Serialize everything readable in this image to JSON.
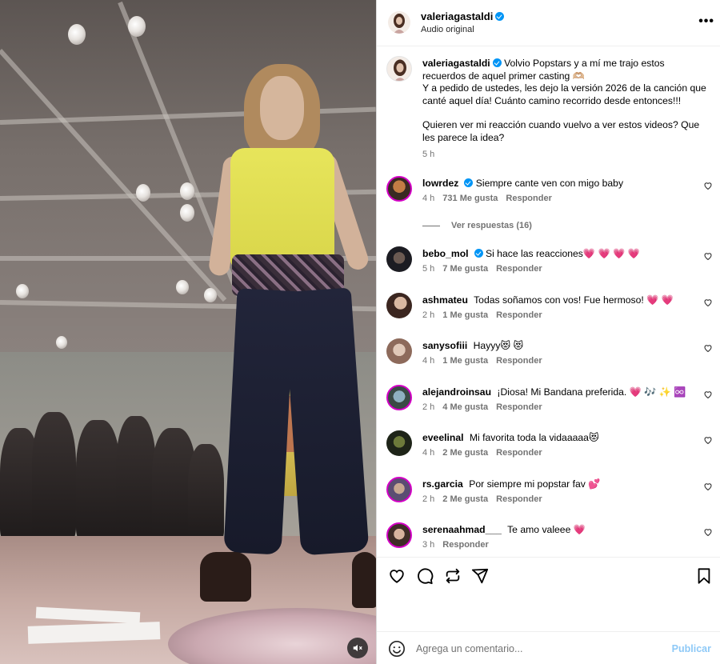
{
  "header": {
    "username": "valeriagastaldi",
    "audio": "Audio original",
    "more": "•••"
  },
  "caption": {
    "username": "valeriagastaldi",
    "line1": "Volvio Popstars y a mí me trajo estos recuerdos de aquel primer casting 🫶🏼",
    "line2": "Y a pedido de ustedes, les dejo la versión 2026 de la canción que canté aquel día! Cuánto camino recorrido desde entonces!!!",
    "line3": "Quieren ver mi reacción cuando vuelvo a ver estos videos? Que les parece la idea?",
    "time": "5 h"
  },
  "comments": [
    {
      "user": "lowrdez",
      "verified": true,
      "text": "Siempre cante ven con migo baby",
      "time": "4 h",
      "likes": "731 Me gusta",
      "reply": "Responder"
    },
    {
      "user": "bebo_mol",
      "verified": true,
      "text": "Si hace las reacciones💗 💗 💗 💗",
      "time": "5 h",
      "likes": "7 Me gusta",
      "reply": "Responder"
    },
    {
      "user": "ashmateu",
      "verified": false,
      "text": "Todas soñamos con vos! Fue hermoso! 💗 💗",
      "time": "2 h",
      "likes": "1 Me gusta",
      "reply": "Responder"
    },
    {
      "user": "sanysofiii",
      "verified": false,
      "text": "Hayyy😻 😻",
      "time": "4 h",
      "likes": "1 Me gusta",
      "reply": "Responder"
    },
    {
      "user": "alejandroinsau",
      "verified": false,
      "text": "¡Diosa! Mi Bandana preferida. 💗 🎶 ✨ ♾️",
      "time": "2 h",
      "likes": "4 Me gusta",
      "reply": "Responder"
    },
    {
      "user": "eveelinal",
      "verified": false,
      "text": "Mi favorita toda la vidaaaaa😻",
      "time": "4 h",
      "likes": "2 Me gusta",
      "reply": "Responder"
    },
    {
      "user": "rs.garcia",
      "verified": false,
      "text": "Por siempre mi popstar fav 💕",
      "time": "2 h",
      "likes": "2 Me gusta",
      "reply": "Responder"
    },
    {
      "user": "serenaahmad___",
      "verified": false,
      "text": "Te amo valeee 💗",
      "time": "3 h",
      "likes": "",
      "reply": "Responder"
    }
  ],
  "replies_label": "Ver respuestas (16)",
  "add_comment": {
    "placeholder": "Agrega un comentario...",
    "publish": "Publicar"
  },
  "colors": {
    "verified": "#0095f6",
    "secondary_text": "#737373",
    "publish_disabled": "#8ec9f7",
    "dancer_top": "#e7e55b"
  },
  "icons": [
    "heart-icon",
    "comment-icon",
    "repost-icon",
    "share-icon",
    "bookmark-icon",
    "emoji-icon",
    "sound-off-icon",
    "more-icon"
  ]
}
